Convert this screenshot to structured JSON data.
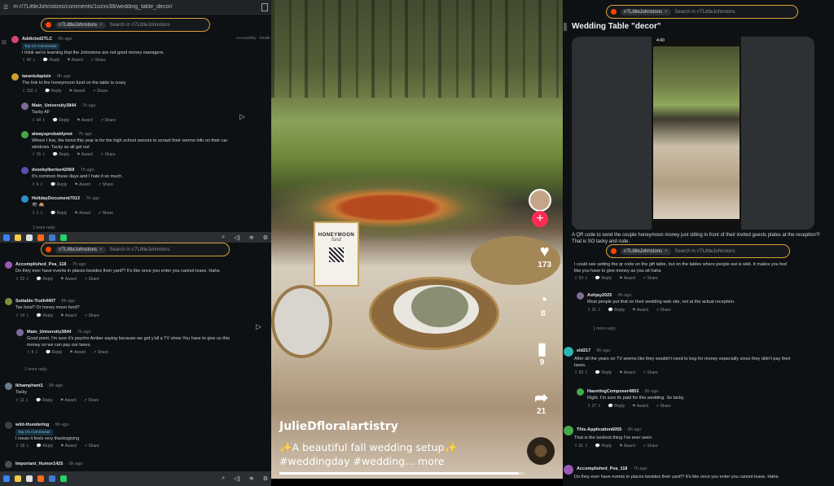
{
  "left": {
    "url": "m r/7LittleJohnstons/comments/1ozxv38/wedding_table_decor/",
    "search_top": {
      "chip": "r/7LittleJohnstons",
      "placeholder": "Search in r/7LittleJohnstons"
    },
    "sidebar_links": [
      "Accessibility",
      "Reddit"
    ],
    "comments_top": [
      {
        "user": "Addicted2TLC",
        "ago": "· 8h ago",
        "badge": "Top 1% Commenter",
        "body": "I think we're learning that the Johnstons are not good money managers.",
        "votes": "40"
      },
      {
        "user": "tarantulapisle",
        "ago": "· 8h ago",
        "body": "The link to the honeymoon fund on the table is crazy",
        "votes": "110"
      },
      {
        "user": "Main_University3844",
        "ago": "· 7h ago",
        "body": "Tacky AF",
        "votes": "44"
      },
      {
        "user": "alwaysprobablynot",
        "ago": "· 7h ago",
        "body": "Where I live, the trend this year is for the high school seniors to scrawl their venmo info on their car",
        "body2": "windows. Tacky as all get out",
        "votes": "15"
      },
      {
        "user": "dvonkylberlee42069",
        "ago": "· 7h ago",
        "body": "It's common these days and I hate it so much.",
        "votes": "6"
      },
      {
        "user": "HolidayDocument7013",
        "ago": "· 7h ago",
        "body": "👁 🙈",
        "votes": "1"
      }
    ],
    "more_replies": "1 more reply",
    "search_bottom": {
      "chip": "r/7LittleJohnstons",
      "placeholder": "Search in r/7LittleJohnstons"
    },
    "comments_bottom": [
      {
        "user": "Accomplished_Pea_118",
        "ago": "· 7h ago",
        "body": "Do they ever have events in places besides their yard?! It's like once you enter you cannot leave. Haha",
        "votes": "22"
      },
      {
        "user": "Suitable-Truth4407",
        "ago": "· 8h ago",
        "body": "Tax fund? Or honey moon fund?",
        "votes": "14"
      },
      {
        "user": "Main_University3844",
        "ago": "· 7h ago",
        "body": "Good point. I'm sure it's psycho Amber saying because we got y'all a TV show You have to give us this",
        "body2": "money so we can pay our taxes.",
        "votes": "5"
      },
      {
        "user": "lkhamphant1",
        "ago": "· 8h ago",
        "body": "Tacky",
        "votes": "11"
      },
      {
        "user": "wild-thundering",
        "ago": "· 9h ago",
        "badge": "Top 1% Commenter",
        "body": "I mean it feels very thanksgiving",
        "votes": "18"
      },
      {
        "user": "Important_Humor1425",
        "ago": "· 8h ago",
        "body": "",
        "votes": ""
      }
    ],
    "more_replies_2": "1 more reply",
    "actions": {
      "reply": "Reply",
      "award": "Award",
      "share": "Share"
    }
  },
  "video": {
    "username": "JulieDfloralartistry",
    "caption": "✨A beautiful fall wedding setup✨ #weddingday #wedding... more",
    "likes": "173",
    "comments": "8",
    "saves": "9",
    "shares": "21",
    "sign_line1": "HONEYMOON",
    "sign_line2": "fund",
    "progress": 0.98
  },
  "right": {
    "search": {
      "chip": "r/7LittleJohnstons",
      "placeholder": "Search in r/7LittleJohnstons"
    },
    "post_title": "Wedding Table \"decor\"",
    "phone_time": "4:40",
    "post_desc": "A QR code to send the couple honeymoon money just sitting in front of their invited guests plates at the reception?! That is SO tacky and rude.",
    "search2": {
      "chip": "r/7LittleJohnstons",
      "placeholder": "Search in r/7LittleJohnstons"
    },
    "comments": [
      {
        "user": "",
        "ago": "",
        "body": "I could see setting the qr code on the gift table, but on the tables where people eat is wild. It makes you feel",
        "body2": "like you have to give money as you sit haha",
        "votes": "53"
      },
      {
        "user": "Ashjay2025",
        "ago": "· 8h ago",
        "body": "Most people put that on their wedding web site, not at the actual reception.",
        "votes": "21"
      },
      {
        "user": "eld217",
        "ago": "· 8h ago",
        "body": "After all the years on TV seems like they wouldn't need to beg for money especially since they didn't pay their",
        "body2": "taxes.",
        "votes": "63"
      },
      {
        "user": "HauntingComposer4853",
        "ago": "· 8h ago",
        "body": "Right. I'm sure tlc paid for this wedding. So tacky.",
        "votes": "27"
      },
      {
        "user": "This-Application6055",
        "ago": "· 8h ago",
        "body": "That is the tackiest thing I've ever seen",
        "votes": "61"
      },
      {
        "user": "Accomplished_Pea_118",
        "ago": "· 7h ago",
        "body": "Do they ever have events in places besides their yard?! It's like once you enter you cannot leave. Haha",
        "votes": ""
      }
    ],
    "more_replies": "1 more reply",
    "actions": {
      "reply": "Reply",
      "award": "Award",
      "share": "Share"
    }
  },
  "colors": {
    "reddit_orange": "#ff4500",
    "search_border": "#d9a23a",
    "tiktok_pink": "#fe2c55"
  }
}
